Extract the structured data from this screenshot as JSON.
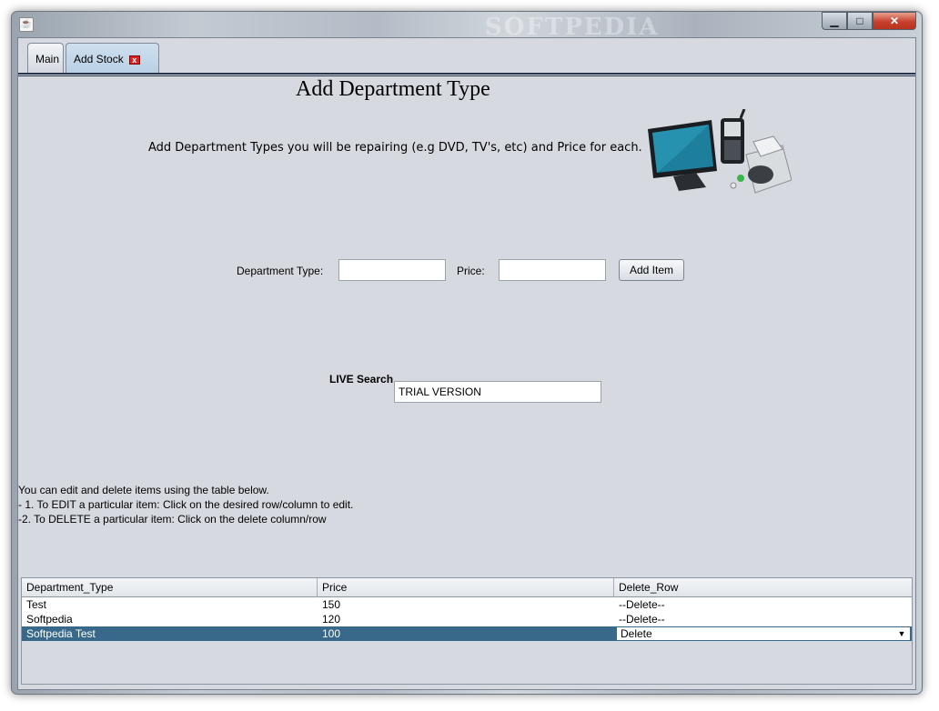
{
  "window": {
    "controls": {
      "minimize": "▁",
      "maximize": "□",
      "close": "✕"
    },
    "watermark": "SOFTPEDIA"
  },
  "tabs": [
    {
      "label": "Main",
      "active": false
    },
    {
      "label": "Add Stock",
      "active": true,
      "close_icon": "x"
    }
  ],
  "page": {
    "title": "Add Department Type",
    "intro": "Add Department Types you will be repairing (e.g DVD, TV's, etc) and Price for each."
  },
  "form": {
    "department_label": "Department Type:",
    "department_value": "",
    "price_label": "Price:",
    "price_value": "",
    "add_button": "Add Item"
  },
  "search": {
    "label": "LIVE Search",
    "value": "TRIAL VERSION"
  },
  "help": {
    "line1": "You can edit and delete items using the table below.",
    "line2": "- 1. To EDIT a particular item: Click on the desired row/column to edit.",
    "line3": "-2. To DELETE a particular item: Click on the delete column/row"
  },
  "table": {
    "columns": [
      "Department_Type",
      "Price",
      "Delete_Row"
    ],
    "rows": [
      {
        "type": "Test",
        "price": "150",
        "delete": "--Delete--"
      },
      {
        "type": "Softpedia",
        "price": "120",
        "delete": "--Delete--"
      },
      {
        "type": "Softpedia Test",
        "price": "100",
        "delete": "Delete"
      }
    ],
    "selection_color": "#39698a"
  }
}
